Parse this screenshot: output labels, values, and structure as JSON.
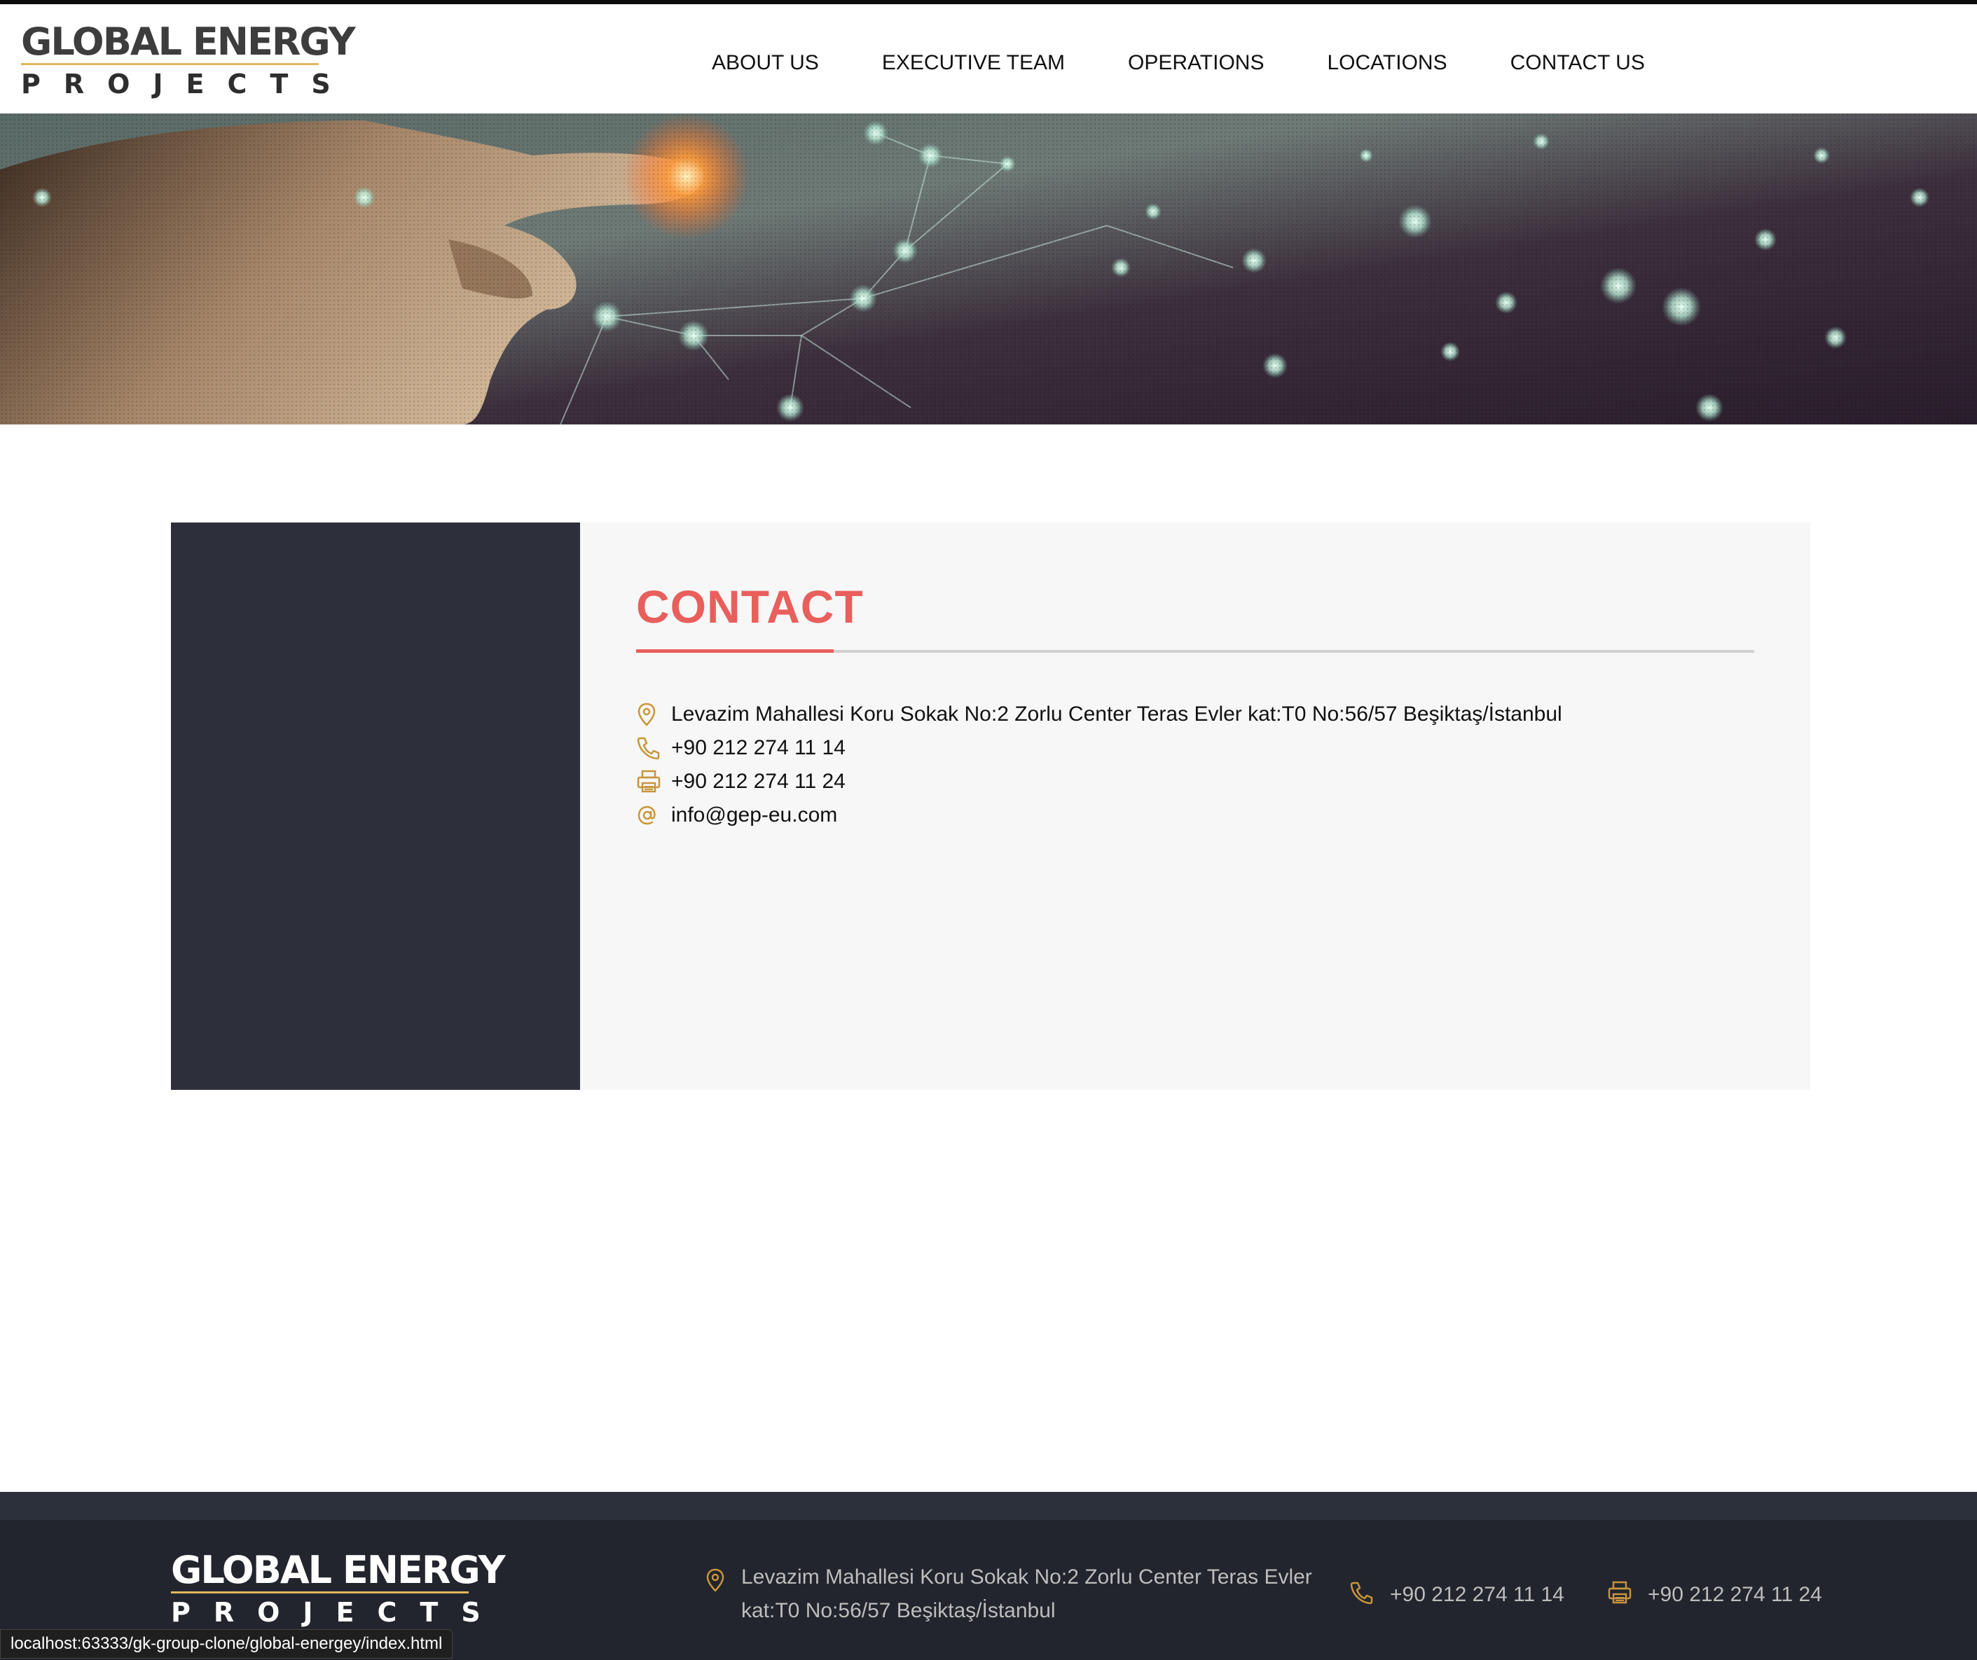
{
  "brand": {
    "line1": "GLOBAL ENERGY",
    "line2": "PROJECTS"
  },
  "nav": [
    {
      "label": "ABOUT US"
    },
    {
      "label": "EXECUTIVE TEAM"
    },
    {
      "label": "OPERATIONS"
    },
    {
      "label": "LOCATIONS"
    },
    {
      "label": "CONTACT US"
    }
  ],
  "contact": {
    "title": "CONTACT",
    "address": "Levazim Mahallesi Koru Sokak No:2 Zorlu Center Teras Evler kat:T0 No:56/57 Beşiktaş/İstanbul",
    "phone": "+90 212 274 11 14",
    "fax": "+90 212 274 11 24",
    "email": "info@gep-eu.com"
  },
  "footer": {
    "address": "Levazim Mahallesi Koru Sokak No:2 Zorlu Center Teras Evler kat:T0 No:56/57 Beşiktaş/İstanbul",
    "phone": "+90 212 274 11 14",
    "fax": "+90 212 274 11 24"
  },
  "status_url": "localhost:63333/gk-group-clone/global-energey/index.html",
  "colors": {
    "accent_red": "#e85f5c",
    "icon_gold": "#c8953a",
    "dark_panel": "#2d303a",
    "footer_bg": "#22252d"
  },
  "icons": {
    "address": "map-pin-icon",
    "phone": "phone-icon",
    "fax": "printer-icon",
    "email": "at-sign-icon"
  }
}
